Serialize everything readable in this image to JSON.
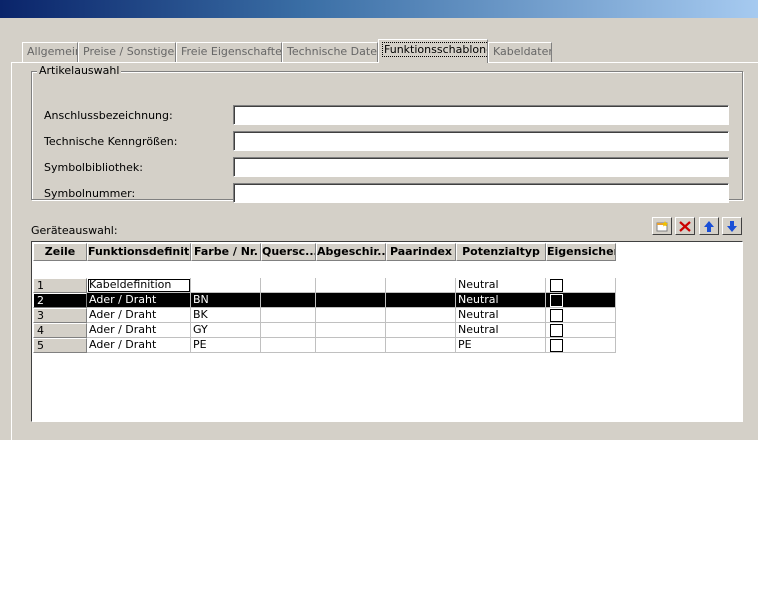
{
  "tabs": [
    "Allgemein",
    "Preise / Sonstiges",
    "Freie Eigenschaften",
    "Technische Daten",
    "Funktionsschablone",
    "Kabeldaten"
  ],
  "active_tab": "Funktionsschablone",
  "article_group": {
    "title": "Artikelauswahl",
    "fields": [
      {
        "label": "Anschlussbezeichnung:",
        "value": ""
      },
      {
        "label": "Technische Kenngrößen:",
        "value": ""
      },
      {
        "label": "Symbolbibliothek:",
        "value": ""
      },
      {
        "label": "Symbolnummer:",
        "value": ""
      }
    ]
  },
  "device_label": "Geräteauswahl:",
  "toolbar": {
    "new_icon": "new-row-icon",
    "delete_icon": "delete-x-icon",
    "up_icon": "arrow-up-icon",
    "down_icon": "arrow-down-icon"
  },
  "grid": {
    "columns": [
      "Zeile",
      "Funktionsdefinit...",
      "Farbe / Nr.",
      "Quersc...",
      "Abgeschir...",
      "Paarindex",
      "Potenzialtyp",
      "Eigensicher"
    ],
    "rows": [
      {
        "zeile": "1",
        "funktion": "Kabeldefinition",
        "farbe": "",
        "quersc": "",
        "abgeschirmt": "",
        "paarindex": "",
        "potenzial": "Neutral",
        "eigensicher": false
      },
      {
        "zeile": "2",
        "funktion": "Ader / Draht",
        "farbe": "BN",
        "quersc": "",
        "abgeschirmt": "",
        "paarindex": "",
        "potenzial": "Neutral",
        "eigensicher": false
      },
      {
        "zeile": "3",
        "funktion": "Ader / Draht",
        "farbe": "BK",
        "quersc": "",
        "abgeschirmt": "",
        "paarindex": "",
        "potenzial": "Neutral",
        "eigensicher": false
      },
      {
        "zeile": "4",
        "funktion": "Ader / Draht",
        "farbe": "GY",
        "quersc": "",
        "abgeschirmt": "",
        "paarindex": "",
        "potenzial": "Neutral",
        "eigensicher": false
      },
      {
        "zeile": "5",
        "funktion": "Ader / Draht",
        "farbe": "PE",
        "quersc": "",
        "abgeschirmt": "",
        "paarindex": "",
        "potenzial": "PE",
        "eigensicher": false
      }
    ],
    "selected_row": "2"
  },
  "colors": {
    "face": "#d4d0c8",
    "selection": "#000000",
    "delete": "#cc0000",
    "arrow": "#1a4fd6"
  }
}
